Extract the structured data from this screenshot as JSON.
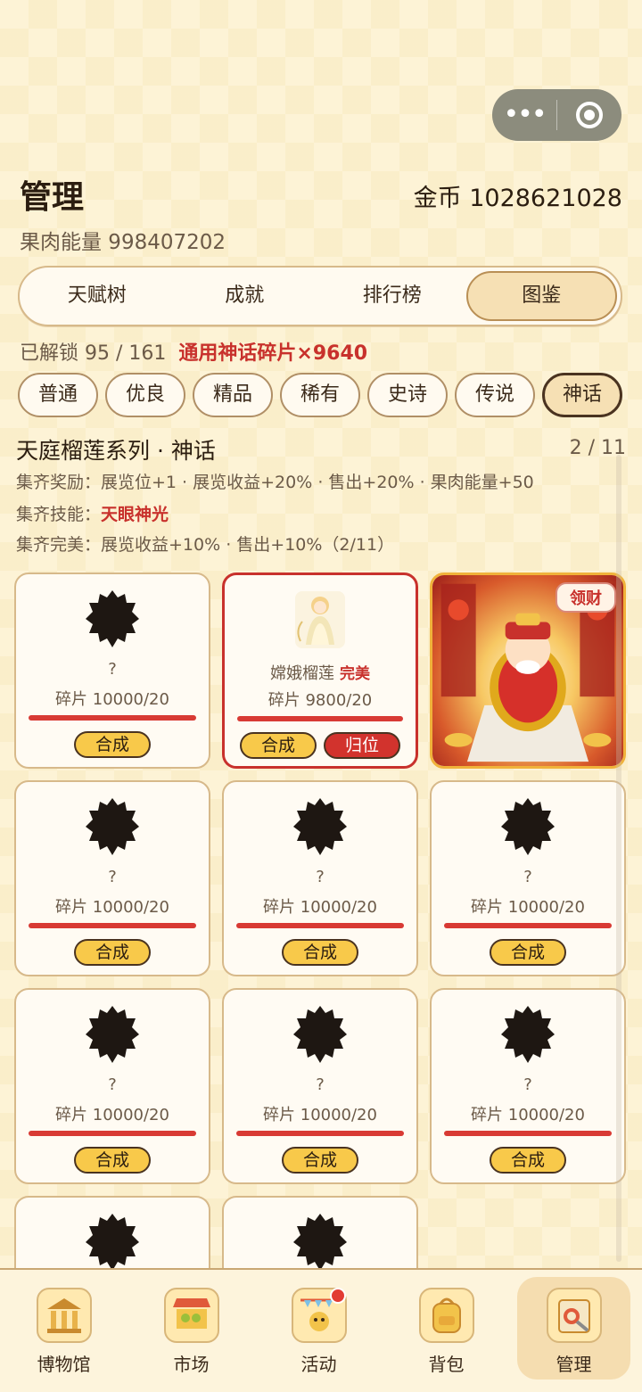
{
  "header": {
    "title": "管理",
    "coins": "金币 1028621028",
    "energy": "果肉能量 998407202"
  },
  "tabs": [
    {
      "label": "天赋树",
      "active": false
    },
    {
      "label": "成就",
      "active": false
    },
    {
      "label": "排行榜",
      "active": false
    },
    {
      "label": "图鉴",
      "active": true
    }
  ],
  "unlock": {
    "text": "已解锁 95 / 161",
    "fragments": "通用神话碎片×9640"
  },
  "rarities": [
    {
      "label": "普通",
      "active": false
    },
    {
      "label": "优良",
      "active": false
    },
    {
      "label": "精品",
      "active": false
    },
    {
      "label": "稀有",
      "active": false
    },
    {
      "label": "史诗",
      "active": false
    },
    {
      "label": "传说",
      "active": false
    },
    {
      "label": "神话",
      "active": true
    }
  ],
  "series": {
    "title": "天庭榴莲系列 · 神话",
    "count": "2 / 11",
    "reward": "集齐奖励：展览位+1 · 展览收益+20% · 售出+20% · 果肉能量+50",
    "skill_prefix": "集齐技能：",
    "skill": "天眼神光",
    "perfect": "集齐完美：展览收益+10% · 售出+10%（2/11）"
  },
  "cards": [
    {
      "name": "?",
      "shards": "碎片 10000/20",
      "merge": "合成"
    },
    {
      "name": "嫦娥榴莲",
      "perfect": "完美",
      "shards": "碎片 9800/20",
      "merge": "合成",
      "return": "归位"
    },
    {
      "badge": "领财"
    },
    {
      "name": "?",
      "shards": "碎片 10000/20",
      "merge": "合成"
    },
    {
      "name": "?",
      "shards": "碎片 10000/20",
      "merge": "合成"
    },
    {
      "name": "?",
      "shards": "碎片 10000/20",
      "merge": "合成"
    },
    {
      "name": "?",
      "shards": "碎片 10000/20",
      "merge": "合成"
    },
    {
      "name": "?",
      "shards": "碎片 10000/20",
      "merge": "合成"
    },
    {
      "name": "?",
      "shards": "碎片 10000/20",
      "merge": "合成"
    }
  ],
  "nav": [
    {
      "label": "博物馆",
      "icon": "museum-icon"
    },
    {
      "label": "市场",
      "icon": "market-icon"
    },
    {
      "label": "活动",
      "icon": "activity-icon",
      "dot": true
    },
    {
      "label": "背包",
      "icon": "backpack-icon"
    },
    {
      "label": "管理",
      "icon": "manage-icon",
      "active": true
    }
  ],
  "colors": {
    "accent_red": "#c8312c",
    "gold": "#f8c94a",
    "background": "#fdf3d6"
  }
}
